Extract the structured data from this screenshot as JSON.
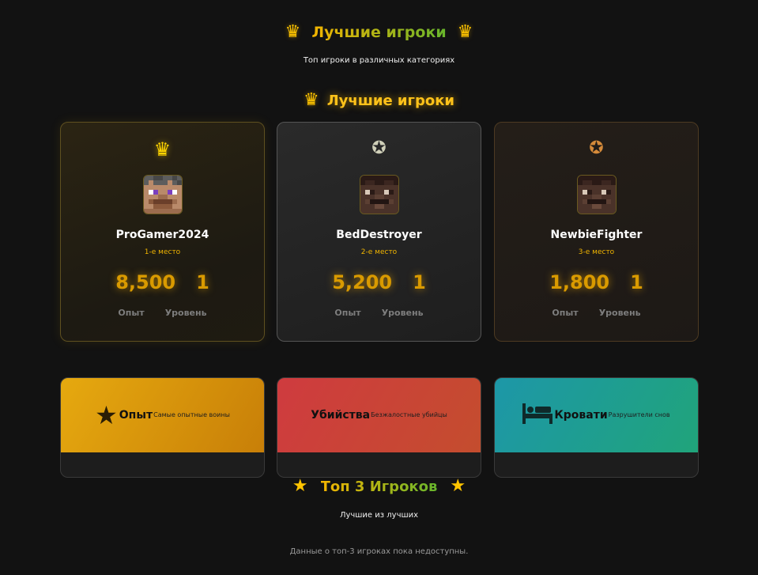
{
  "header": {
    "title": "Лучшие игроки",
    "subtitle": "Топ игроки в различных категориях",
    "crown_icon": "crown-icon"
  },
  "leaders": {
    "title": "Лучшие игроки",
    "players": [
      {
        "rank_icon": "crown-icon",
        "name": "ProGamer2024",
        "place": "1-е место",
        "xp": "8,500",
        "level": "1",
        "xp_label": "Опыт",
        "level_label": "Уровень"
      },
      {
        "rank_icon": "silver-medal-icon",
        "name": "BedDestroyer",
        "place": "2-е место",
        "xp": "5,200",
        "level": "1",
        "xp_label": "Опыт",
        "level_label": "Уровень"
      },
      {
        "rank_icon": "bronze-medal-icon",
        "name": "NewbieFighter",
        "place": "3-е место",
        "xp": "1,800",
        "level": "1",
        "xp_label": "Опыт",
        "level_label": "Уровень"
      }
    ]
  },
  "categories": [
    {
      "icon": "star-icon",
      "name": "Опыт",
      "desc": "Самые опытные воины",
      "color": "#e6a90f"
    },
    {
      "icon": "skull-icon",
      "name": "Убийства",
      "desc": "Безжалостные убийцы",
      "color": "#cf3b3f"
    },
    {
      "icon": "bed-icon",
      "name": "Кровати",
      "desc": "Разрушители снов",
      "color": "#1d97a8"
    }
  ],
  "top3": {
    "title": "Топ 3 Игроков",
    "subtitle": "Лучшие из лучших",
    "empty_message": "Данные о топ-3 игроках пока недоступны."
  },
  "colors": {
    "background": "#121212",
    "gold": "#ffc21a",
    "green": "#67b52c"
  }
}
